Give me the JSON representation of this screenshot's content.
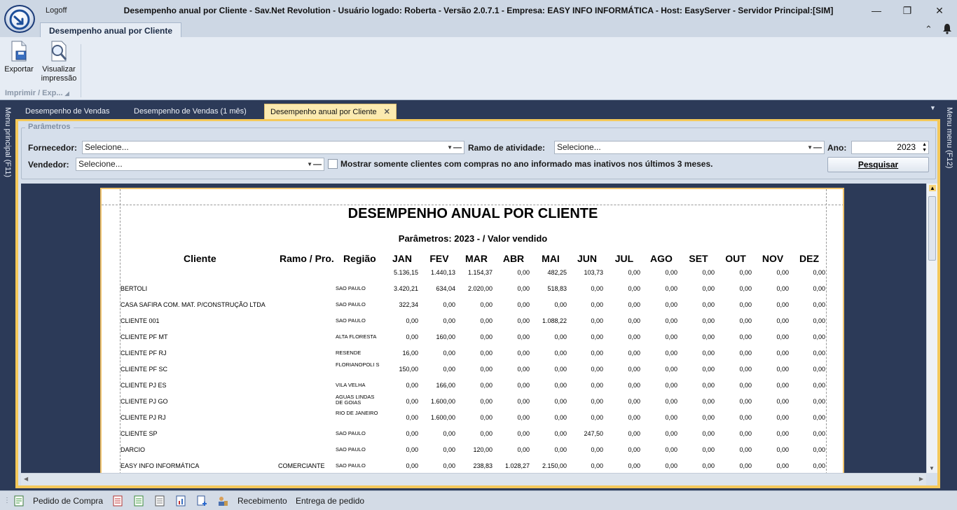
{
  "window": {
    "logoff": "Logoff",
    "title": "Desempenho anual por Cliente - Sav.Net Revolution - Usuário logado: Roberta - Versão 2.0.7.1 - Empresa: EASY INFO INFORMÁTICA - Host: EasyServer - Servidor Principal:[SIM]"
  },
  "ribbon": {
    "tab": "Desempenho anual por Cliente",
    "export_label": "Exportar",
    "preview_label_1": "Visualizar",
    "preview_label_2": "impressão",
    "group_label": "Imprimir / Exp..."
  },
  "side": {
    "left": "Menu principal (F11)",
    "right": "Menu menu (F12)"
  },
  "doc_tabs": [
    {
      "label": "Desempenho de Vendas"
    },
    {
      "label": "Desempenho de Vendas (1 mês)"
    },
    {
      "label": "Desempenho anual por Cliente"
    }
  ],
  "params": {
    "legend": "Parâmetros",
    "fornecedor_label": "Fornecedor:",
    "fornecedor_value": "Selecione...",
    "ramo_label": "Ramo de atividade:",
    "ramo_value": "Selecione...",
    "ano_label": "Ano:",
    "ano_value": "2023",
    "vendedor_label": "Vendedor:",
    "vendedor_value": "Selecione...",
    "inativos_label": "Mostrar somente clientes com compras no ano informado mas inativos nos últimos 3 meses.",
    "search_button": "Pesquisar"
  },
  "report": {
    "title": "DESEMPENHO ANUAL POR CLIENTE",
    "params_line": "Parâmetros: 2023 -  / Valor vendido",
    "headers": {
      "cliente": "Cliente",
      "ramo": "Ramo / Pro.",
      "regiao": "Região",
      "months": [
        "JAN",
        "FEV",
        "MAR",
        "ABR",
        "MAI",
        "JUN",
        "JUL",
        "AGO",
        "SET",
        "OUT",
        "NOV",
        "DEZ"
      ]
    },
    "totals": [
      "5.136,15",
      "1.440,13",
      "1.154,37",
      "0,00",
      "482,25",
      "103,73",
      "0,00",
      "0,00",
      "0,00",
      "0,00",
      "0,00",
      "0,00"
    ],
    "rows": [
      {
        "cliente": "BERTOLI",
        "ramo": "",
        "regiao": "SAO PAULO",
        "values": [
          "3.420,21",
          "634,04",
          "2.020,00",
          "0,00",
          "518,83",
          "0,00",
          "0,00",
          "0,00",
          "0,00",
          "0,00",
          "0,00",
          "0,00"
        ]
      },
      {
        "cliente": "CASA SAFIRA COM. MAT. P/CONSTRUÇÃO LTDA",
        "ramo": "",
        "regiao": "SAO PAULO",
        "values": [
          "322,34",
          "0,00",
          "0,00",
          "0,00",
          "0,00",
          "0,00",
          "0,00",
          "0,00",
          "0,00",
          "0,00",
          "0,00",
          "0,00"
        ]
      },
      {
        "cliente": "CLIENTE 001",
        "ramo": "",
        "regiao": "SAO PAULO",
        "values": [
          "0,00",
          "0,00",
          "0,00",
          "0,00",
          "1.088,22",
          "0,00",
          "0,00",
          "0,00",
          "0,00",
          "0,00",
          "0,00",
          "0,00"
        ]
      },
      {
        "cliente": "CLIENTE PF MT",
        "ramo": "",
        "regiao": "ALTA FLORESTA",
        "values": [
          "0,00",
          "160,00",
          "0,00",
          "0,00",
          "0,00",
          "0,00",
          "0,00",
          "0,00",
          "0,00",
          "0,00",
          "0,00",
          "0,00"
        ]
      },
      {
        "cliente": "CLIENTE PF RJ",
        "ramo": "",
        "regiao": "RESENDE",
        "values": [
          "16,00",
          "0,00",
          "0,00",
          "0,00",
          "0,00",
          "0,00",
          "0,00",
          "0,00",
          "0,00",
          "0,00",
          "0,00",
          "0,00"
        ]
      },
      {
        "cliente": "CLIENTE PF SC",
        "ramo": "",
        "regiao": "FLORIANOPOLI S",
        "values": [
          "150,00",
          "0,00",
          "0,00",
          "0,00",
          "0,00",
          "0,00",
          "0,00",
          "0,00",
          "0,00",
          "0,00",
          "0,00",
          "0,00"
        ]
      },
      {
        "cliente": "CLIENTE PJ ES",
        "ramo": "",
        "regiao": "VILA VELHA",
        "values": [
          "0,00",
          "166,00",
          "0,00",
          "0,00",
          "0,00",
          "0,00",
          "0,00",
          "0,00",
          "0,00",
          "0,00",
          "0,00",
          "0,00"
        ]
      },
      {
        "cliente": "CLIENTE PJ GO",
        "ramo": "",
        "regiao": "AGUAS LINDAS DE GOIAS",
        "values": [
          "0,00",
          "1.600,00",
          "0,00",
          "0,00",
          "0,00",
          "0,00",
          "0,00",
          "0,00",
          "0,00",
          "0,00",
          "0,00",
          "0,00"
        ]
      },
      {
        "cliente": "CLIENTE PJ RJ",
        "ramo": "",
        "regiao": "RIO DE JANEIRO",
        "values": [
          "0,00",
          "1.600,00",
          "0,00",
          "0,00",
          "0,00",
          "0,00",
          "0,00",
          "0,00",
          "0,00",
          "0,00",
          "0,00",
          "0,00"
        ]
      },
      {
        "cliente": "CLIENTE SP",
        "ramo": "",
        "regiao": "SAO PAULO",
        "values": [
          "0,00",
          "0,00",
          "0,00",
          "0,00",
          "0,00",
          "247,50",
          "0,00",
          "0,00",
          "0,00",
          "0,00",
          "0,00",
          "0,00"
        ]
      },
      {
        "cliente": "DARCIO",
        "ramo": "",
        "regiao": "SAO PAULO",
        "values": [
          "0,00",
          "0,00",
          "120,00",
          "0,00",
          "0,00",
          "0,00",
          "0,00",
          "0,00",
          "0,00",
          "0,00",
          "0,00",
          "0,00"
        ]
      },
      {
        "cliente": "EASY INFO INFORMÁTICA",
        "ramo": "COMERCIANTE",
        "regiao": "SAO PAULO",
        "values": [
          "0,00",
          "0,00",
          "238,83",
          "1.028,27",
          "2.150,00",
          "0,00",
          "0,00",
          "0,00",
          "0,00",
          "0,00",
          "0,00",
          "0,00"
        ]
      }
    ]
  },
  "statusbar": {
    "pedido_compra": "Pedido de Compra",
    "recebimento": "Recebimento",
    "entrega": "Entrega de pedido"
  },
  "colors": {
    "accent": "#f4c85a",
    "dark_bg": "#2c3a58",
    "panel": "#d6dfeb"
  }
}
